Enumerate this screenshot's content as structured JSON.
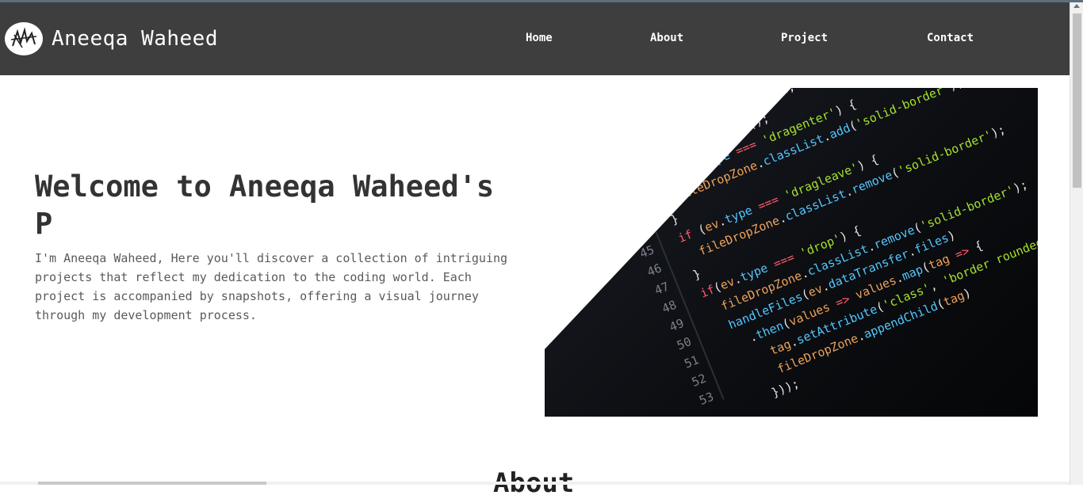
{
  "header": {
    "brand": "Aneeqa Waheed",
    "logo_icon": "signature-logo-icon",
    "nav": [
      {
        "label": "Home"
      },
      {
        "label": "About"
      },
      {
        "label": "Project"
      },
      {
        "label": "Contact"
      }
    ]
  },
  "hero": {
    "title": "Welcome to Aneeqa Waheed's P",
    "description": "I'm Aneeqa Waheed, Here you'll discover a collection of intriguing projects that reflect my dedication to the coding world. Each project is accompanied by snapshots, offering a visual journey through my development process."
  },
  "about": {
    "heading": "About"
  },
  "colors": {
    "navbar": "#3e3e3e",
    "title": "#333333",
    "text": "#5a5a5a"
  }
}
